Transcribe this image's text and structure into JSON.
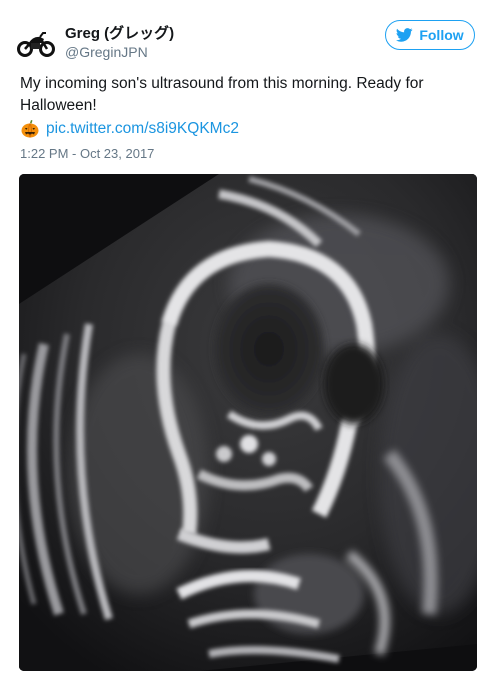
{
  "user": {
    "display_name": "Greg (グレッグ)",
    "handle": "@GreginJPN",
    "avatar_icon": "motorcycle-icon"
  },
  "follow_button": {
    "label": "Follow",
    "icon": "twitter-bird-icon",
    "color": "#1da1f2"
  },
  "tweet": {
    "text_line1": "My incoming son's ultrasound from this morning. Ready for",
    "text_line2": "Halloween!",
    "emoji_icon": "jack-o-lantern-icon",
    "link": "pic.twitter.com/s8i9KQKMc2",
    "link_color": "#1b95e0",
    "timestamp": "1:22 PM - Oct 23, 2017"
  },
  "media": {
    "kind": "ultrasound-photo"
  }
}
